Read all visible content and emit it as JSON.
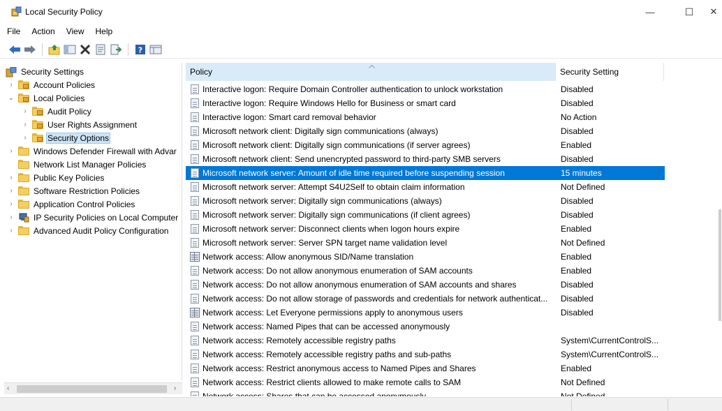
{
  "window": {
    "title": "Local Security Policy",
    "minimize_glyph": "—",
    "maximize_glyph": "☐",
    "close_glyph": "✕"
  },
  "menu": [
    "File",
    "Action",
    "View",
    "Help"
  ],
  "toolbar": {
    "buttons": [
      "back-icon",
      "forward-icon",
      "up-folder-icon",
      "show-hide-tree-icon",
      "delete-icon",
      "properties-icon",
      "export-list-icon",
      "help-icon",
      "view-icon"
    ]
  },
  "tree": {
    "items": [
      {
        "label": "Security Settings",
        "level": 0,
        "expander": "",
        "icon": "security-settings-icon"
      },
      {
        "label": "Account Policies",
        "level": 1,
        "expander": "›",
        "icon": "folder-lock-icon"
      },
      {
        "label": "Local Policies",
        "level": 1,
        "expander": "⌄",
        "icon": "folder-lock-icon"
      },
      {
        "label": "Audit Policy",
        "level": 2,
        "expander": "›",
        "icon": "folder-lock-icon"
      },
      {
        "label": "User Rights Assignment",
        "level": 2,
        "expander": "›",
        "icon": "folder-lock-icon"
      },
      {
        "label": "Security Options",
        "level": 2,
        "expander": "›",
        "icon": "folder-lock-icon",
        "selected": true
      },
      {
        "label": "Windows Defender Firewall with Advar",
        "level": 0,
        "expander": "›",
        "icon": "folder-icon"
      },
      {
        "label": "Network List Manager Policies",
        "level": 0,
        "expander": "",
        "icon": "folder-icon"
      },
      {
        "label": "Public Key Policies",
        "level": 0,
        "expander": "›",
        "icon": "folder-icon"
      },
      {
        "label": "Software Restriction Policies",
        "level": 0,
        "expander": "›",
        "icon": "folder-icon"
      },
      {
        "label": "Application Control Policies",
        "level": 0,
        "expander": "›",
        "icon": "folder-icon"
      },
      {
        "label": "IP Security Policies on Local Computer",
        "level": 0,
        "expander": "›",
        "icon": "ip-security-icon"
      },
      {
        "label": "Advanced Audit Policy Configuration",
        "level": 0,
        "expander": "›",
        "icon": "folder-icon"
      }
    ]
  },
  "list": {
    "columns": {
      "policy": "Policy",
      "setting": "Security Setting"
    },
    "rows": [
      {
        "policy": "Interactive logon: Require Domain Controller authentication to unlock workstation",
        "setting": "Disabled",
        "icon": "policy-doc-icon"
      },
      {
        "policy": "Interactive logon: Require Windows Hello for Business or smart card",
        "setting": "Disabled",
        "icon": "policy-doc-icon"
      },
      {
        "policy": "Interactive logon: Smart card removal behavior",
        "setting": "No Action",
        "icon": "policy-doc-icon"
      },
      {
        "policy": "Microsoft network client: Digitally sign communications (always)",
        "setting": "Disabled",
        "icon": "policy-doc-icon"
      },
      {
        "policy": "Microsoft network client: Digitally sign communications (if server agrees)",
        "setting": "Enabled",
        "icon": "policy-doc-icon"
      },
      {
        "policy": "Microsoft network client: Send unencrypted password to third-party SMB servers",
        "setting": "Disabled",
        "icon": "policy-doc-icon"
      },
      {
        "policy": "Microsoft network server: Amount of idle time required before suspending session",
        "setting": "15 minutes",
        "icon": "policy-doc-icon",
        "selected": true
      },
      {
        "policy": "Microsoft network server: Attempt S4U2Self to obtain claim information",
        "setting": "Not Defined",
        "icon": "policy-doc-icon"
      },
      {
        "policy": "Microsoft network server: Digitally sign communications (always)",
        "setting": "Disabled",
        "icon": "policy-doc-icon"
      },
      {
        "policy": "Microsoft network server: Digitally sign communications (if client agrees)",
        "setting": "Disabled",
        "icon": "policy-doc-icon"
      },
      {
        "policy": "Microsoft network server: Disconnect clients when logon hours expire",
        "setting": "Enabled",
        "icon": "policy-doc-icon"
      },
      {
        "policy": "Microsoft network server: Server SPN target name validation level",
        "setting": "Not Defined",
        "icon": "policy-doc-icon"
      },
      {
        "policy": "Network access: Allow anonymous SID/Name translation",
        "setting": "Enabled",
        "icon": "policy-grid-icon"
      },
      {
        "policy": "Network access: Do not allow anonymous enumeration of SAM accounts",
        "setting": "Enabled",
        "icon": "policy-doc-icon"
      },
      {
        "policy": "Network access: Do not allow anonymous enumeration of SAM accounts and shares",
        "setting": "Disabled",
        "icon": "policy-doc-icon"
      },
      {
        "policy": "Network access: Do not allow storage of passwords and credentials for network authenticat...",
        "setting": "Disabled",
        "icon": "policy-doc-icon"
      },
      {
        "policy": "Network access: Let Everyone permissions apply to anonymous users",
        "setting": "Disabled",
        "icon": "policy-grid-icon"
      },
      {
        "policy": "Network access: Named Pipes that can be accessed anonymously",
        "setting": "",
        "icon": "policy-doc-icon"
      },
      {
        "policy": "Network access: Remotely accessible registry paths",
        "setting": "System\\CurrentControlS...",
        "icon": "policy-doc-icon"
      },
      {
        "policy": "Network access: Remotely accessible registry paths and sub-paths",
        "setting": "System\\CurrentControlS...",
        "icon": "policy-doc-icon"
      },
      {
        "policy": "Network access: Restrict anonymous access to Named Pipes and Shares",
        "setting": "Enabled",
        "icon": "policy-doc-icon"
      },
      {
        "policy": "Network access: Restrict clients allowed to make remote calls to SAM",
        "setting": "Not Defined",
        "icon": "policy-doc-icon"
      },
      {
        "policy": "Network access: Shares that can be accessed anonymously",
        "setting": "Not Defined",
        "icon": "policy-doc-icon"
      }
    ]
  },
  "scrollbar": {
    "left_arrow": "‹",
    "right_arrow": "›"
  },
  "colors": {
    "selection": "#0078d7",
    "tree_selection": "#cce4f7",
    "header_sorted": "#d9ebf9"
  }
}
